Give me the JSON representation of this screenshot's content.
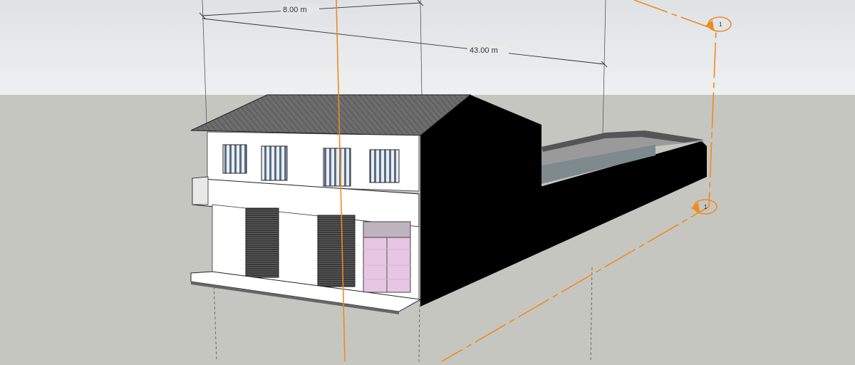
{
  "model": {
    "dimensions": [
      {
        "label": "8.00 m"
      },
      {
        "label": "43.00 m"
      }
    ],
    "section_markers": [
      {
        "label": "1"
      },
      {
        "label": "1"
      }
    ]
  },
  "colors": {
    "sky_top": "#dfe2e5",
    "sky_bottom": "#eef0f1",
    "ground": "#c6c6c1",
    "section_plane": "#f08a1c",
    "wall_white": "#ffffff",
    "wall_shadow": "#000000",
    "roof": "#6a6a6a",
    "door_pink": "#e6c6e2"
  }
}
